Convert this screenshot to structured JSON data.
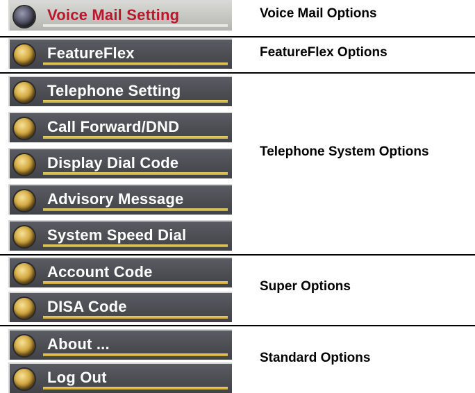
{
  "menu": {
    "items": [
      {
        "label": "Voice Mail Setting",
        "active": true
      },
      {
        "label": "FeatureFlex",
        "active": false
      },
      {
        "label": "Telephone Setting",
        "active": false
      },
      {
        "label": "Call Forward/DND",
        "active": false
      },
      {
        "label": "Display Dial Code",
        "active": false
      },
      {
        "label": "Advisory Message",
        "active": false
      },
      {
        "label": "System Speed Dial",
        "active": false
      },
      {
        "label": "Account Code",
        "active": false
      },
      {
        "label": "DISA Code",
        "active": false
      },
      {
        "label": "About ...",
        "active": false
      },
      {
        "label": "Log Out",
        "active": false
      }
    ]
  },
  "groups": [
    {
      "label": "Voice Mail Options"
    },
    {
      "label": "FeatureFlex Options"
    },
    {
      "label": "Telephone System Options"
    },
    {
      "label": "Super Options"
    },
    {
      "label": "Standard Options"
    }
  ],
  "colors": {
    "active_label": "#b8192a",
    "button_bg": "#4c4d53",
    "accent_gold": "#d6ad47",
    "divider": "#000000"
  }
}
